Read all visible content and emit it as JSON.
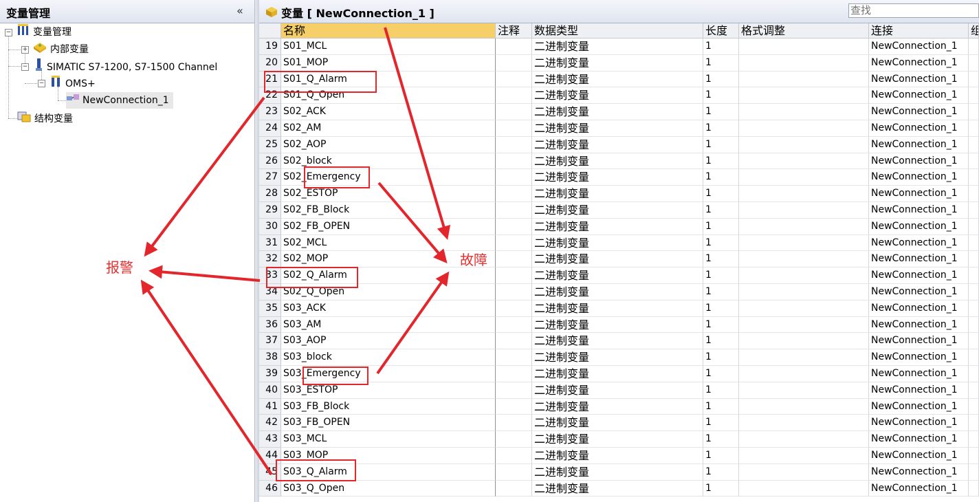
{
  "left_panel": {
    "title": "变量管理",
    "collapse": "«",
    "tree": [
      {
        "label": "变量管理",
        "icon": "tag-group-icon",
        "expanded": true
      },
      {
        "label": "内部变量",
        "icon": "internal-tags-icon",
        "expanded": false
      },
      {
        "label": "SIMATIC S7-1200, S7-1500 Channel",
        "icon": "channel-icon",
        "expanded": true
      },
      {
        "label": "OMS+",
        "icon": "tag-group-icon",
        "expanded": true
      },
      {
        "label": "NewConnection_1",
        "icon": "connection-icon",
        "selected": true
      },
      {
        "label": "结构变量",
        "icon": "struct-tags-icon"
      }
    ]
  },
  "right_panel": {
    "title": "变量 [ NewConnection_1 ]",
    "search_placeholder": "查找",
    "columns": [
      "名称",
      "注释",
      "数据类型",
      "长度",
      "格式调整",
      "连接",
      "组"
    ],
    "rows": [
      {
        "n": "19",
        "name": "S01_MCL",
        "type": "二进制变量",
        "len": "1",
        "conn": "NewConnection_1"
      },
      {
        "n": "20",
        "name": "S01_MOP",
        "type": "二进制变量",
        "len": "1",
        "conn": "NewConnection_1"
      },
      {
        "n": "21",
        "name": "S01_Q_Alarm",
        "type": "二进制变量",
        "len": "1",
        "conn": "NewConnection_1"
      },
      {
        "n": "22",
        "name": "S01_Q_Open",
        "type": "二进制变量",
        "len": "1",
        "conn": "NewConnection_1"
      },
      {
        "n": "23",
        "name": "S02_ACK",
        "type": "二进制变量",
        "len": "1",
        "conn": "NewConnection_1"
      },
      {
        "n": "24",
        "name": "S02_AM",
        "type": "二进制变量",
        "len": "1",
        "conn": "NewConnection_1"
      },
      {
        "n": "25",
        "name": "S02_AOP",
        "type": "二进制变量",
        "len": "1",
        "conn": "NewConnection_1"
      },
      {
        "n": "26",
        "name": "S02_block",
        "type": "二进制变量",
        "len": "1",
        "conn": "NewConnection_1"
      },
      {
        "n": "27",
        "name": "S02_Emergency",
        "type": "二进制变量",
        "len": "1",
        "conn": "NewConnection_1"
      },
      {
        "n": "28",
        "name": "S02_ESTOP",
        "type": "二进制变量",
        "len": "1",
        "conn": "NewConnection_1"
      },
      {
        "n": "29",
        "name": "S02_FB_Block",
        "type": "二进制变量",
        "len": "1",
        "conn": "NewConnection_1"
      },
      {
        "n": "30",
        "name": "S02_FB_OPEN",
        "type": "二进制变量",
        "len": "1",
        "conn": "NewConnection_1"
      },
      {
        "n": "31",
        "name": "S02_MCL",
        "type": "二进制变量",
        "len": "1",
        "conn": "NewConnection_1"
      },
      {
        "n": "32",
        "name": "S02_MOP",
        "type": "二进制变量",
        "len": "1",
        "conn": "NewConnection_1"
      },
      {
        "n": "33",
        "name": "S02_Q_Alarm",
        "type": "二进制变量",
        "len": "1",
        "conn": "NewConnection_1"
      },
      {
        "n": "34",
        "name": "S02_Q_Open",
        "type": "二进制变量",
        "len": "1",
        "conn": "NewConnection_1"
      },
      {
        "n": "35",
        "name": "S03_ACK",
        "type": "二进制变量",
        "len": "1",
        "conn": "NewConnection_1"
      },
      {
        "n": "36",
        "name": "S03_AM",
        "type": "二进制变量",
        "len": "1",
        "conn": "NewConnection_1"
      },
      {
        "n": "37",
        "name": "S03_AOP",
        "type": "二进制变量",
        "len": "1",
        "conn": "NewConnection_1"
      },
      {
        "n": "38",
        "name": "S03_block",
        "type": "二进制变量",
        "len": "1",
        "conn": "NewConnection_1"
      },
      {
        "n": "39",
        "name": "S03_Emergency",
        "type": "二进制变量",
        "len": "1",
        "conn": "NewConnection_1"
      },
      {
        "n": "40",
        "name": "S03_ESTOP",
        "type": "二进制变量",
        "len": "1",
        "conn": "NewConnection_1"
      },
      {
        "n": "41",
        "name": "S03_FB_Block",
        "type": "二进制变量",
        "len": "1",
        "conn": "NewConnection_1"
      },
      {
        "n": "42",
        "name": "S03_FB_OPEN",
        "type": "二进制变量",
        "len": "1",
        "conn": "NewConnection_1"
      },
      {
        "n": "43",
        "name": "S03_MCL",
        "type": "二进制变量",
        "len": "1",
        "conn": "NewConnection_1"
      },
      {
        "n": "44",
        "name": "S03_MOP",
        "type": "二进制变量",
        "len": "1",
        "conn": "NewConnection_1"
      },
      {
        "n": "45",
        "name": "S03_Q_Alarm",
        "type": "二进制变量",
        "len": "1",
        "conn": "NewConnection_1"
      },
      {
        "n": "46",
        "name": "S03_Q_Open",
        "type": "二进制变量",
        "len": "1",
        "conn": "NewConnection_1"
      }
    ]
  },
  "annotations": {
    "alarm_label": "报警",
    "fault_label": "故障",
    "color": "#e53030"
  }
}
